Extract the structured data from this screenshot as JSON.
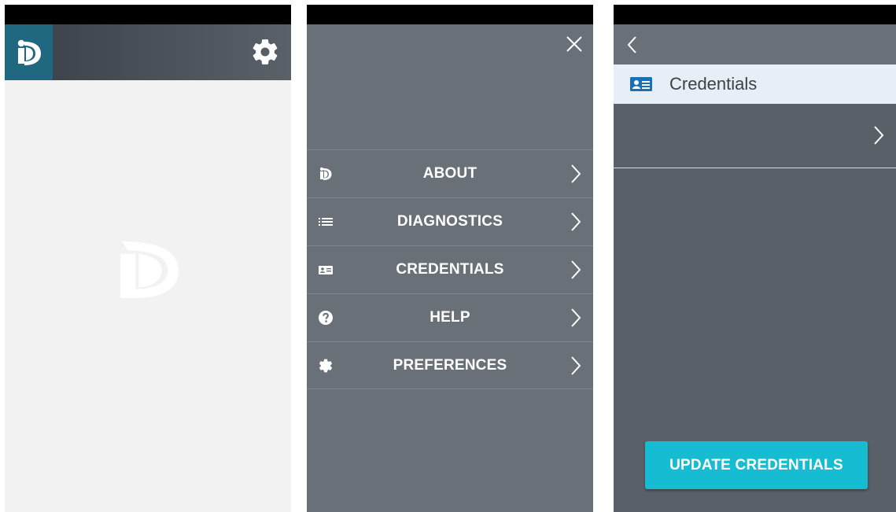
{
  "screen_home": {
    "logo_icon": "id-logo-icon",
    "settings_icon": "gear-icon",
    "splash_icon": "id-logo-icon",
    "colors": {
      "logo_bg": "#20687f",
      "content_bg": "#f2f2f2"
    }
  },
  "screen_menu": {
    "close_icon": "close-icon",
    "items": [
      {
        "label": "ABOUT",
        "icon": "id-logo-icon"
      },
      {
        "label": "DIAGNOSTICS",
        "icon": "list-icon"
      },
      {
        "label": "CREDENTIALS",
        "icon": "id-card-icon"
      },
      {
        "label": "HELP",
        "icon": "help-icon"
      },
      {
        "label": "PREFERENCES",
        "icon": "gear-icon"
      }
    ],
    "colors": {
      "bg": "#6a7077"
    }
  },
  "screen_credentials": {
    "back_icon": "back-chevron-icon",
    "header_title": "Credentials",
    "header_icon": "id-card-icon",
    "update_button_label": "UPDATE CREDENTIALS",
    "colors": {
      "accent": "#16bcd2",
      "header_bg": "#e7eef5",
      "bg": "#5a6068"
    }
  }
}
